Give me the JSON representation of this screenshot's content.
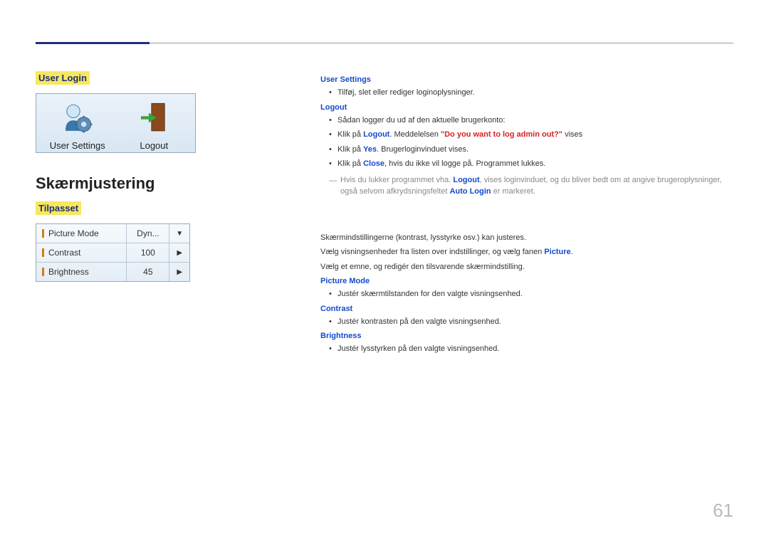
{
  "section1": {
    "title": "User Login",
    "icons": {
      "userSettings": "User Settings",
      "logout": "Logout"
    }
  },
  "section2": {
    "heading": "Skærmjustering",
    "subtitle": "Tilpasset",
    "table": {
      "rows": [
        {
          "label": "Picture Mode",
          "value": "Dyn...",
          "ctrl": "▼"
        },
        {
          "label": "Contrast",
          "value": "100",
          "ctrl": "▶"
        },
        {
          "label": "Brightness",
          "value": "45",
          "ctrl": "▶"
        }
      ]
    }
  },
  "right": {
    "userSettings": {
      "title": "User Settings",
      "bullets": [
        "Tilføj, slet eller rediger loginoplysninger."
      ]
    },
    "logout": {
      "title": "Logout",
      "b1": "Sådan logger du ud af den aktuelle brugerkonto:",
      "b2_pre": "Klik på ",
      "b2_logout": "Logout",
      "b2_mid": ". Meddelelsen ",
      "b2_msg": "\"Do you want to log admin out?\"",
      "b2_post": " vises",
      "b3_pre": "Klik på ",
      "b3_yes": "Yes",
      "b3_post": ". Brugerloginvinduet vises.",
      "b4_pre": "Klik på ",
      "b4_close": "Close",
      "b4_post": ", hvis du ikke vil logge på. Programmet lukkes.",
      "note_pre": "Hvis du lukker programmet vha. ",
      "note_logout": "Logout",
      "note_mid": ", vises loginvinduet, og du bliver bedt om at angive brugeroplysninger, også selvom afkrydsningsfeltet ",
      "note_auto": "Auto Login",
      "note_post": " er markeret."
    },
    "adjust": {
      "p1": "Skærmindstillingerne (kontrast, lysstyrke osv.) kan justeres.",
      "p2_pre": "Vælg visningsenheder fra listen over indstillinger, og vælg fanen ",
      "p2_pic": "Picture",
      "p2_post": ".",
      "p3": "Vælg et emne, og redigér den tilsvarende skærmindstilling.",
      "pictureMode": {
        "title": "Picture Mode",
        "bullet": "Justér skærmtilstanden for den valgte visningsenhed."
      },
      "contrast": {
        "title": "Contrast",
        "bullet": "Justér kontrasten på den valgte visningsenhed."
      },
      "brightness": {
        "title": "Brightness",
        "bullet": "Justér lysstyrken på den valgte visningsenhed."
      }
    }
  },
  "pageNum": "61"
}
